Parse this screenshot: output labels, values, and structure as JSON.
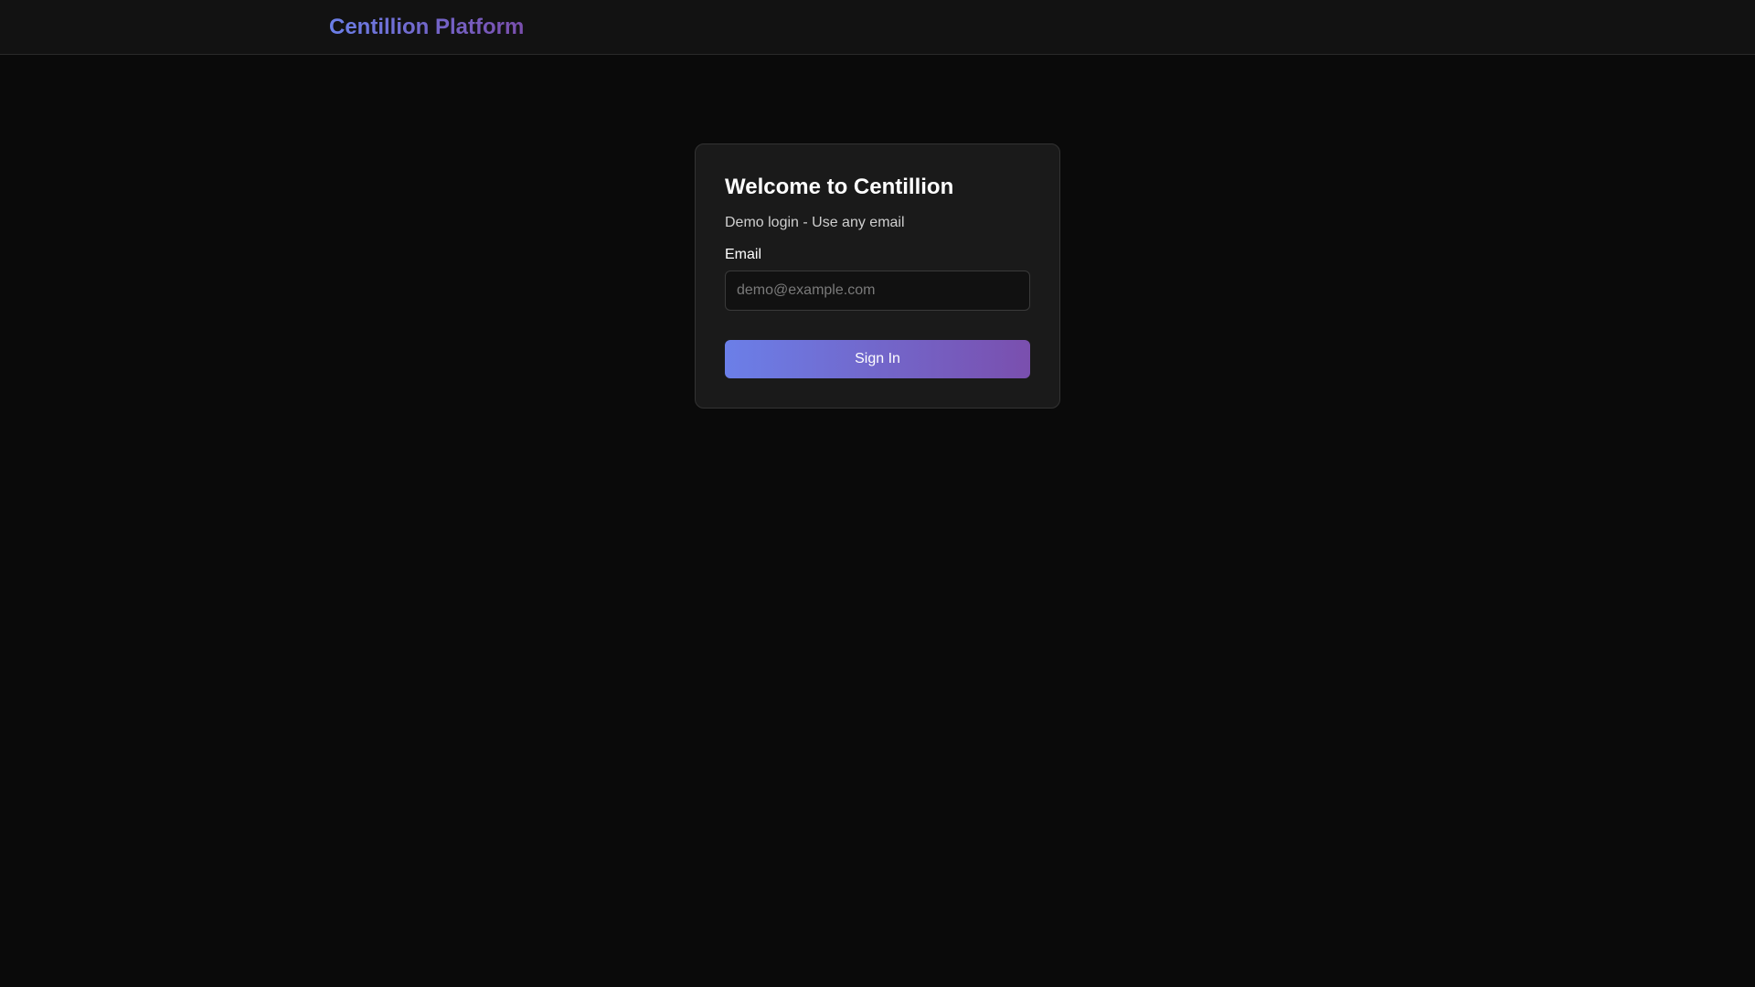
{
  "header": {
    "brand": "Centillion Platform"
  },
  "login": {
    "title": "Welcome to Centillion",
    "subtitle": "Demo login - Use any email",
    "email_label": "Email",
    "email_placeholder": "demo@example.com",
    "email_value": "",
    "submit_label": "Sign In"
  },
  "colors": {
    "page_background": "#0a0a0a",
    "header_background": "#121212",
    "card_background": "#1a1a1a",
    "accent_gradient_start": "#6b7fe8",
    "accent_gradient_end": "#7a4fae"
  }
}
